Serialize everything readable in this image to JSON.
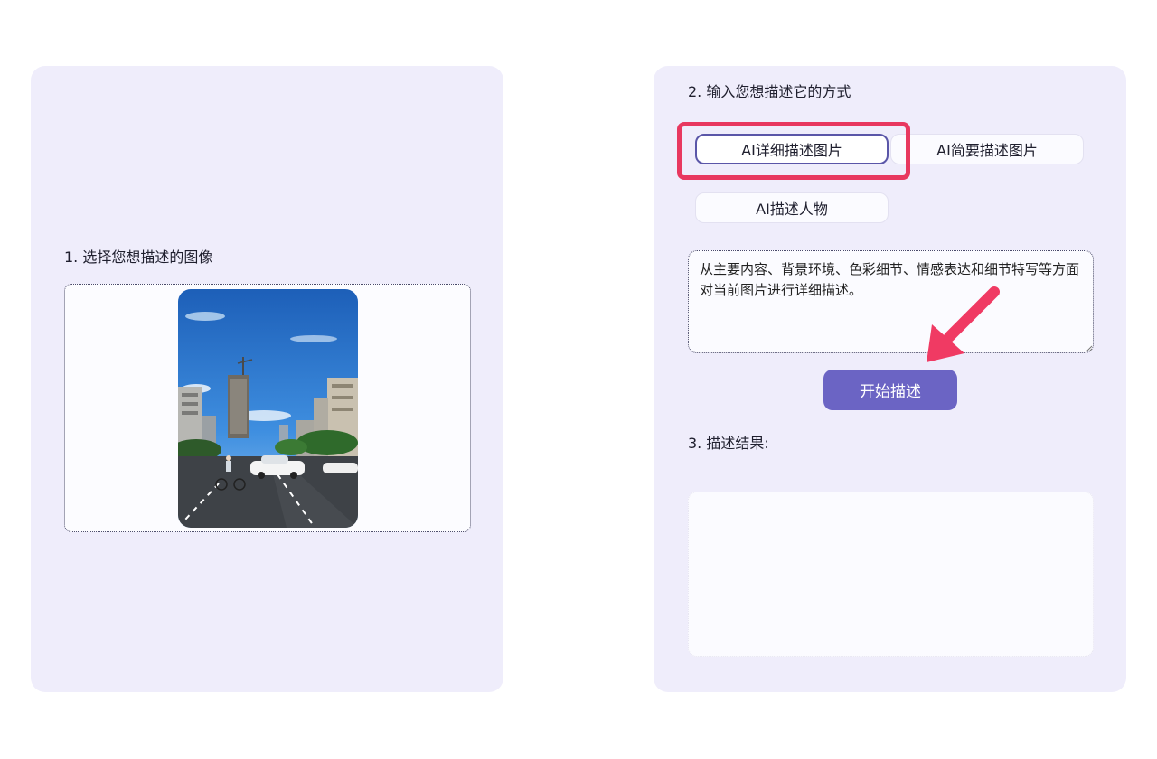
{
  "left_panel": {
    "step1_title": "1. 选择您想描述的图像"
  },
  "right_panel": {
    "step2_title": "2. 输入您想描述它的方式",
    "options": [
      {
        "label": "AI详细描述图片",
        "selected": true
      },
      {
        "label": "AI简要描述图片",
        "selected": false
      },
      {
        "label": "AI描述人物",
        "selected": false
      }
    ],
    "prompt_text": "从主要内容、背景环境、色彩细节、情感表达和细节特写等方面对当前图片进行详细描述。",
    "start_button": "开始描述",
    "step3_title": "3. 描述结果:",
    "result_text": ""
  },
  "colors": {
    "panel_bg": "#efedfb",
    "accent": "#6b64c4",
    "highlight": "#e8385f"
  },
  "icons": [
    "red-arrow-annotation-icon",
    "resize-grip-icon"
  ]
}
